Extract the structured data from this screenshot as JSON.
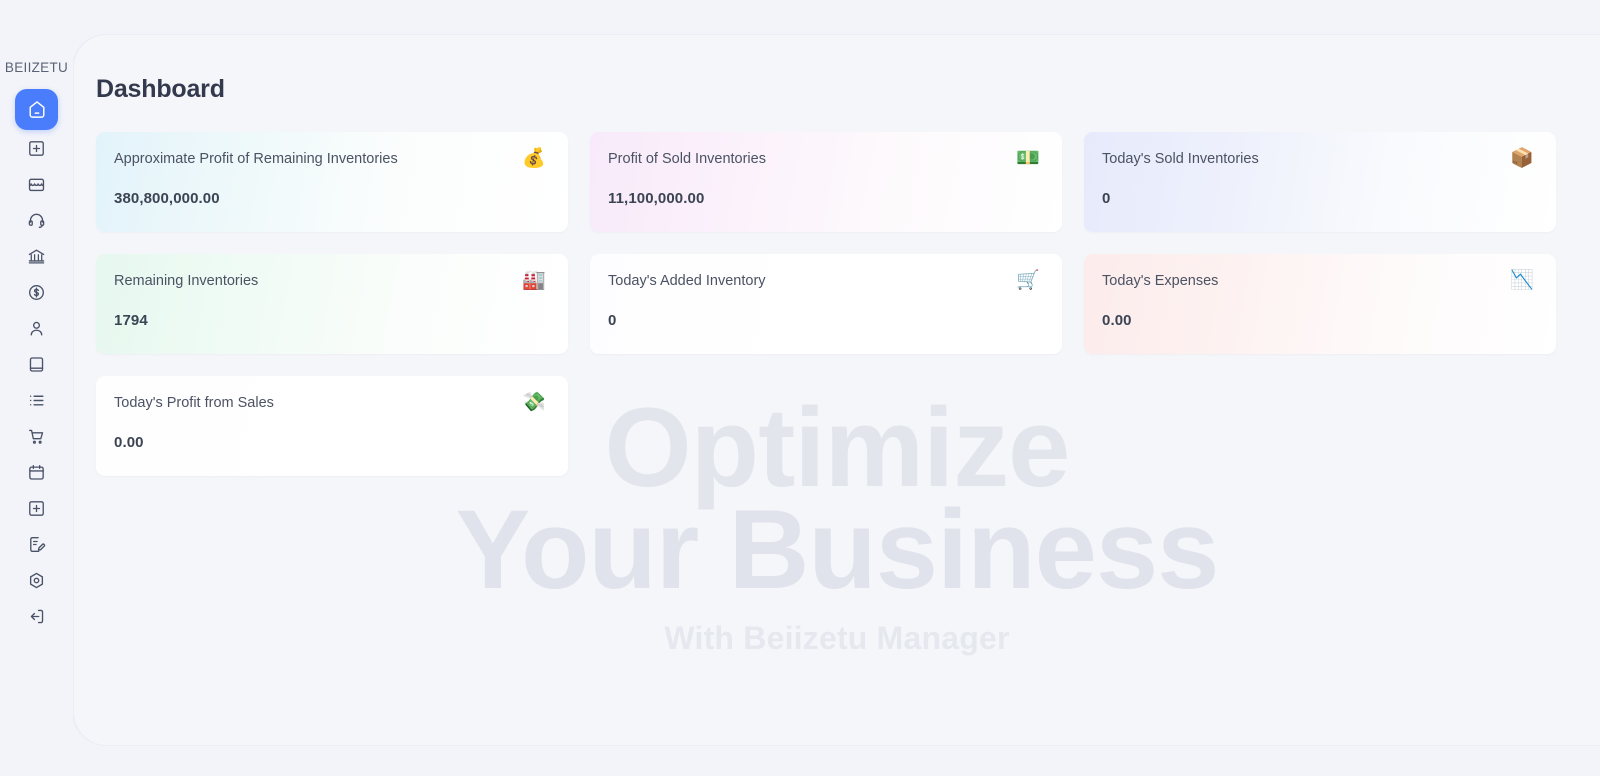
{
  "brand": {
    "name": "BEIIZETU"
  },
  "sidebar": {
    "items": [
      {
        "name": "home",
        "icon": "home-icon",
        "active": true
      },
      {
        "name": "add-box",
        "icon": "plus-square-icon",
        "active": false
      },
      {
        "name": "store",
        "icon": "store-icon",
        "active": false
      },
      {
        "name": "support",
        "icon": "headset-icon",
        "active": false
      },
      {
        "name": "bank",
        "icon": "bank-icon",
        "active": false
      },
      {
        "name": "finance",
        "icon": "dollar-circle-icon",
        "active": false
      },
      {
        "name": "customers",
        "icon": "user-icon",
        "active": false
      },
      {
        "name": "ledger",
        "icon": "book-icon",
        "active": false
      },
      {
        "name": "lists",
        "icon": "list-icon",
        "active": false
      },
      {
        "name": "purchases",
        "icon": "shopping-cart-icon",
        "active": false
      },
      {
        "name": "calendar",
        "icon": "calendar-icon",
        "active": false
      },
      {
        "name": "add-record",
        "icon": "plus-square-icon",
        "active": false
      },
      {
        "name": "reports",
        "icon": "file-edit-icon",
        "active": false
      },
      {
        "name": "settings",
        "icon": "settings-hex-icon",
        "active": false
      },
      {
        "name": "logout",
        "icon": "logout-icon",
        "active": false
      }
    ]
  },
  "header": {
    "title": "Dashboard"
  },
  "cards": [
    {
      "label": "Approximate Profit of Remaining Inventories",
      "value": "380,800,000.00",
      "icon": "💰",
      "icon_name": "money-bag-icon",
      "theme": "g-blue"
    },
    {
      "label": "Profit of Sold Inventories",
      "value": "11,100,000.00",
      "icon": "💵",
      "icon_name": "banknote-icon",
      "theme": "g-pink"
    },
    {
      "label": "Today's Sold Inventories",
      "value": "0",
      "icon": "📦",
      "icon_name": "package-icon",
      "theme": "g-violet"
    },
    {
      "label": "Remaining Inventories",
      "value": "1794",
      "icon": "🏭",
      "icon_name": "factory-icon",
      "theme": "g-green"
    },
    {
      "label": "Today's Added Inventory",
      "value": "0",
      "icon": "🛒",
      "icon_name": "shopping-cart-icon",
      "theme": "g-white"
    },
    {
      "label": "Today's Expenses",
      "value": "0.00",
      "icon": "📉",
      "icon_name": "chart-down-icon",
      "theme": "g-red"
    },
    {
      "label": "Today's Profit from Sales",
      "value": "0.00",
      "icon": "💸",
      "icon_name": "money-wings-icon",
      "theme": "g-plain"
    }
  ],
  "watermark": {
    "line1": "Optimize",
    "line2": "Your Business",
    "line3": "With Beiizetu Manager"
  },
  "colors": {
    "accent": "#4a7dfc",
    "background": "#f3f4f9",
    "panel": "#f5f6fa",
    "text_primary": "#333a4d",
    "text_secondary": "#4b5263",
    "watermark": "#e3e5ed"
  }
}
